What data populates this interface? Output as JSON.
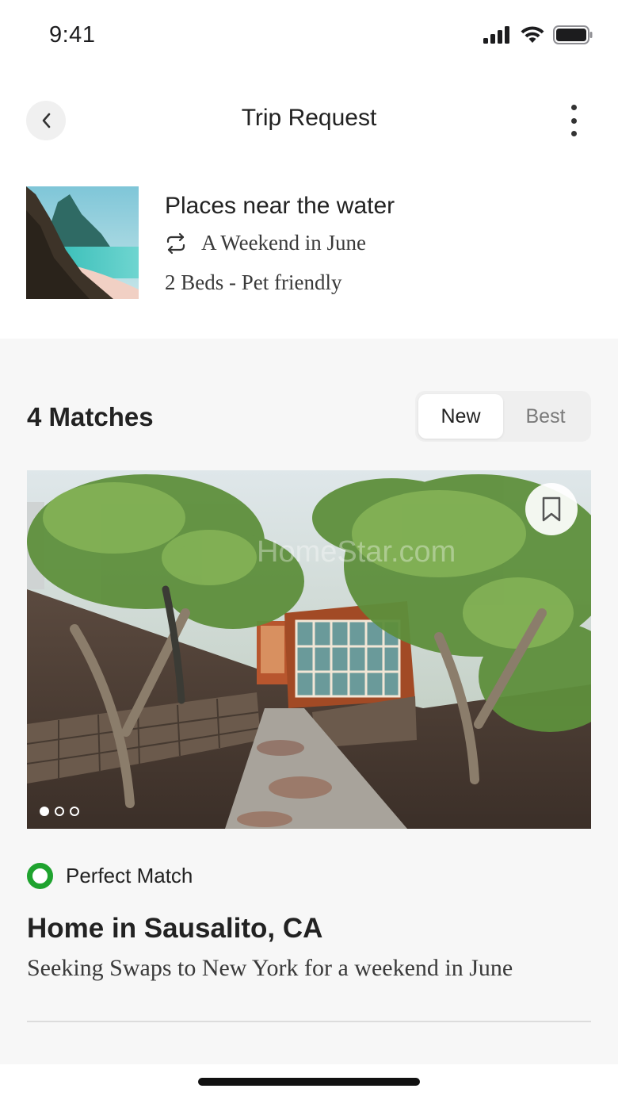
{
  "status_bar": {
    "time": "9:41"
  },
  "header": {
    "title": "Trip Request"
  },
  "trip": {
    "title": "Places near the water",
    "dates": "A Weekend in June",
    "details": "2 Beds - Pet friendly"
  },
  "matches": {
    "title": "4 Matches",
    "tabs": [
      {
        "label": "New",
        "selected": true
      },
      {
        "label": "Best",
        "selected": false
      }
    ]
  },
  "listing": {
    "photo_count": 3,
    "active_photo": 1,
    "match_label": "Perfect Match",
    "title": "Home in Sausalito, CA",
    "subtitle": "Seeking Swaps to New York for a weekend in June"
  },
  "colors": {
    "match_green": "#1fa32f",
    "background_section": "#f7f7f7"
  }
}
